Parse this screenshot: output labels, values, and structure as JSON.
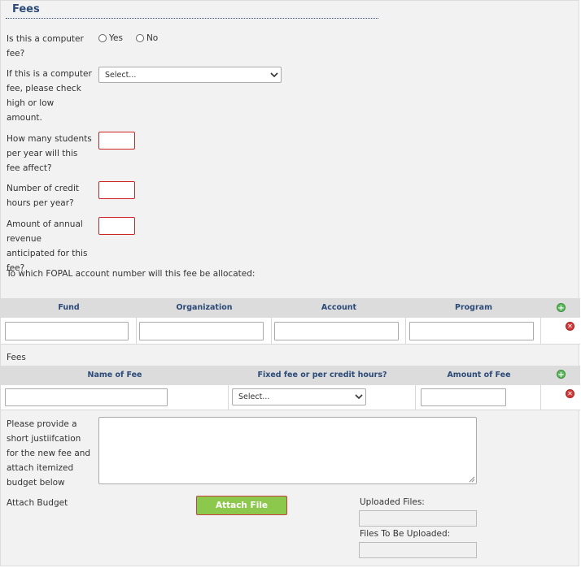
{
  "section": {
    "title": "Fees"
  },
  "computer_fee": {
    "question": "Is this a computer fee?",
    "yes_label": "Yes",
    "no_label": "No"
  },
  "high_low": {
    "question": "If this is a computer fee, please check high or low amount.",
    "select_value": "Select..."
  },
  "students": {
    "question": "How many students per year will this fee affect?"
  },
  "credit_hours": {
    "question": "Number of credit hours per year?"
  },
  "revenue": {
    "question": "Amount of annual revenue anticipated for this fee?"
  },
  "fopal": {
    "question": "To which FOPAL account number will this fee be allocated:",
    "columns": [
      "Fund",
      "Organization",
      "Account",
      "Program"
    ]
  },
  "fees_table": {
    "label": "Fees",
    "columns": [
      "Name of Fee",
      "Fixed fee or per credit hours?",
      "Amount of Fee"
    ],
    "select_value": "Select..."
  },
  "justification": {
    "question": "Please provide a short justiifcation for the new fee and attach itemized budget below"
  },
  "budget": {
    "label": "Attach Budget",
    "attach_button": "Attach File",
    "uploaded_label": "Uploaded Files:",
    "to_upload_label": "Files To Be Uploaded:"
  },
  "colors": {
    "title": "#2b4a78",
    "required_border": "#cc2222",
    "attach_button": "#8cc84b",
    "add_icon": "#5cb85c",
    "delete_icon": "#d33a3a"
  },
  "icons": [
    "chevron-down-icon",
    "add-row-icon",
    "delete-row-icon",
    "resize-grip-icon"
  ]
}
